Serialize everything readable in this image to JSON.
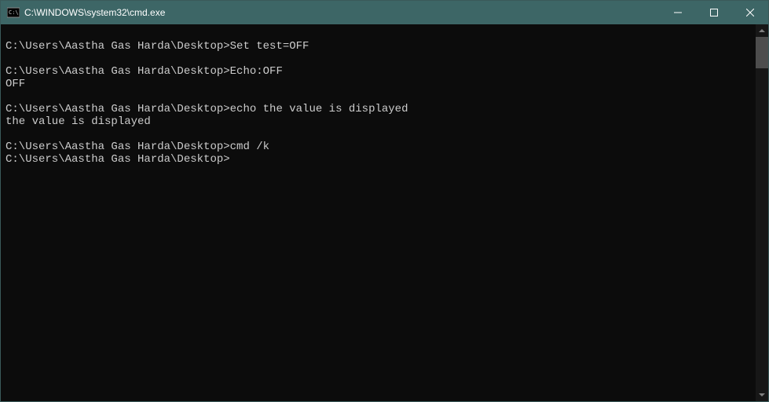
{
  "window": {
    "title": "C:\\WINDOWS\\system32\\cmd.exe"
  },
  "terminal": {
    "lines": [
      "",
      "C:\\Users\\Aastha Gas Harda\\Desktop>Set test=OFF",
      "",
      "C:\\Users\\Aastha Gas Harda\\Desktop>Echo:OFF",
      "OFF",
      "",
      "C:\\Users\\Aastha Gas Harda\\Desktop>echo the value is displayed",
      "the value is displayed",
      "",
      "C:\\Users\\Aastha Gas Harda\\Desktop>cmd /k",
      "C:\\Users\\Aastha Gas Harda\\Desktop>"
    ]
  }
}
